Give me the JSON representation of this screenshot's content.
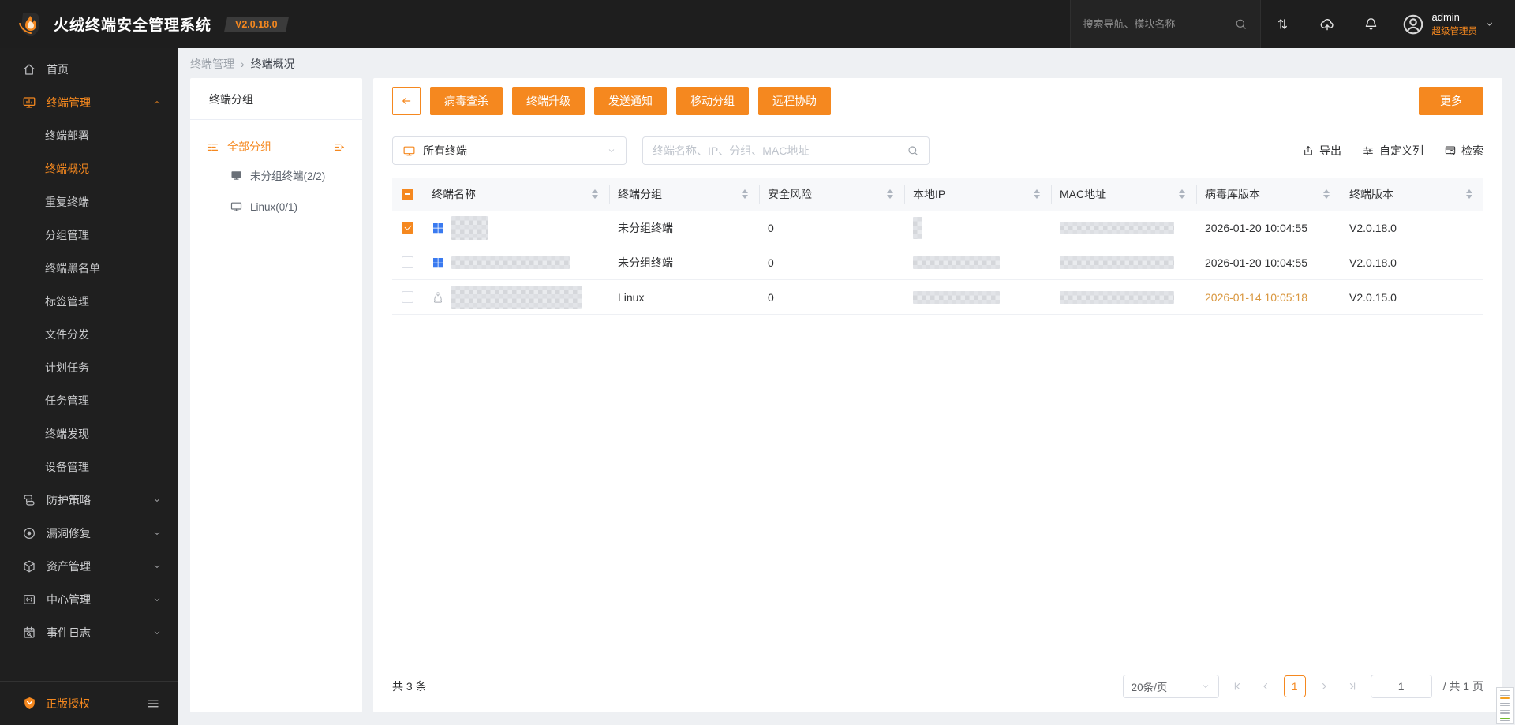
{
  "topbar": {
    "title": "火绒终端安全管理系统",
    "version": "V2.0.18.0",
    "search_placeholder": "搜索导航、模块名称",
    "user_name": "admin",
    "user_role": "超级管理员"
  },
  "sidebar": {
    "menu": [
      {
        "label": "首页",
        "icon": "home-icon",
        "state": "none",
        "children": []
      },
      {
        "label": "终端管理",
        "icon": "terminal-icon",
        "state": "expanded",
        "active": true,
        "active_child": "终端概况",
        "children": [
          "终端部署",
          "终端概况",
          "重复终端",
          "分组管理",
          "终端黑名单",
          "标签管理",
          "文件分发",
          "计划任务",
          "任务管理",
          "终端发现",
          "设备管理"
        ]
      },
      {
        "label": "防护策略",
        "icon": "policy-icon",
        "state": "collapsed",
        "children": []
      },
      {
        "label": "漏洞修复",
        "icon": "vulnerability-icon",
        "state": "collapsed",
        "children": []
      },
      {
        "label": "资产管理",
        "icon": "asset-icon",
        "state": "collapsed",
        "children": []
      },
      {
        "label": "中心管理",
        "icon": "center-icon",
        "state": "collapsed",
        "children": []
      },
      {
        "label": "事件日志",
        "icon": "event-log-icon",
        "state": "collapsed",
        "children": []
      }
    ],
    "license_label": "正版授权"
  },
  "breadcrumb": {
    "parent": "终端管理",
    "separator": "›",
    "current": "终端概况"
  },
  "group_panel": {
    "title": "终端分组",
    "root_label": "全部分组",
    "nodes": [
      {
        "label": "未分组终端(2/2)",
        "icon": "monitor-filled-icon"
      },
      {
        "label": "Linux(0/1)",
        "icon": "monitor-outline-icon"
      }
    ]
  },
  "toolbar": {
    "buttons": [
      "病毒查杀",
      "终端升级",
      "发送通知",
      "移动分组",
      "远程协助"
    ],
    "more_label": "更多"
  },
  "filters": {
    "terminal_select": "所有终端",
    "search_placeholder": "终端名称、IP、分组、MAC地址",
    "actions": [
      {
        "label": "导出",
        "icon": "export-icon"
      },
      {
        "label": "自定义列",
        "icon": "custom-columns-icon"
      },
      {
        "label": "检索",
        "icon": "retrieve-icon"
      }
    ]
  },
  "table": {
    "columns": [
      "终端名称",
      "终端分组",
      "安全风险",
      "本地IP",
      "MAC地址",
      "病毒库版本",
      "终端版本"
    ],
    "header_checkbox": "indeterminate",
    "rows": [
      {
        "checked": true,
        "os": "windows",
        "name_redacted": [
          46,
          30
        ],
        "group": "未分组终端",
        "risk": "0",
        "ip_redacted": [
          12,
          28
        ],
        "mac_redacted": [
          145,
          16
        ],
        "virus_db": "2026-01-20 10:04:55",
        "virus_db_warn": false,
        "version": "V2.0.18.0"
      },
      {
        "checked": false,
        "os": "windows",
        "name_redacted": [
          150,
          16
        ],
        "group": "未分组终端",
        "risk": "0",
        "ip_redacted": [
          110,
          16
        ],
        "mac_redacted": [
          145,
          16
        ],
        "virus_db": "2026-01-20 10:04:55",
        "virus_db_warn": false,
        "version": "V2.0.18.0"
      },
      {
        "checked": false,
        "os": "linux",
        "name_redacted": [
          165,
          30
        ],
        "group": "Linux",
        "risk": "0",
        "ip_redacted": [
          110,
          16
        ],
        "mac_redacted": [
          145,
          16
        ],
        "virus_db": "2026-01-14 10:05:18",
        "virus_db_warn": true,
        "version": "V2.0.15.0"
      }
    ]
  },
  "table_footer": {
    "total": "共 3 条",
    "page_size": "20条/页",
    "current_page": "1",
    "page_input": "1",
    "total_pages_label": "/ 共 1 页"
  },
  "minimap": {
    "bars": [
      "#aeb2ba",
      "#b5b9c0",
      "#aeb2ba",
      "#f5a020",
      "#b5b9c0",
      "#aeb2ba",
      "#b5b9c0",
      "#aeb2ba",
      "#b5b9c0",
      "#aeb2ba",
      "#b5b9c0",
      "#6fba2c",
      "#aeb2ba"
    ]
  },
  "colors": {
    "accent": "#f5881f",
    "warn_date": "#d9973f",
    "windows_blue": "#3a7af0"
  }
}
